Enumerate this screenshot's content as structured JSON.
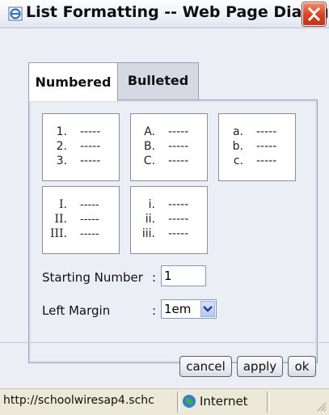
{
  "window": {
    "title": "List Formatting -- Web Page Dialog",
    "close_icon": "close-x-icon"
  },
  "tabs": [
    {
      "label": "Numbered",
      "selected": true
    },
    {
      "label": "Bulleted",
      "selected": false
    }
  ],
  "styles": [
    {
      "markers": [
        "1.",
        "2.",
        "3."
      ],
      "dashes": "-----"
    },
    {
      "markers": [
        "A.",
        "B.",
        "C."
      ],
      "dashes": "-----"
    },
    {
      "markers": [
        "a.",
        "b.",
        "c."
      ],
      "dashes": "-----"
    },
    {
      "markers": [
        "I.",
        "II.",
        "III."
      ],
      "dashes": "-----"
    },
    {
      "markers": [
        "i.",
        "ii.",
        "iii."
      ],
      "dashes": "-----"
    }
  ],
  "form": {
    "starting_number_label": "Starting Number",
    "starting_number_colon": ":",
    "starting_number_value": "1",
    "left_margin_label": "Left Margin",
    "left_margin_colon": ":",
    "left_margin_value": "1em"
  },
  "buttons": {
    "cancel": "cancel",
    "apply": "apply",
    "ok": "ok"
  },
  "status": {
    "url": "http://schoolwiresap4.schc",
    "zone": "Internet"
  },
  "colors": {
    "accent_blue": "#7f9db9",
    "close_red": "#d94022"
  }
}
